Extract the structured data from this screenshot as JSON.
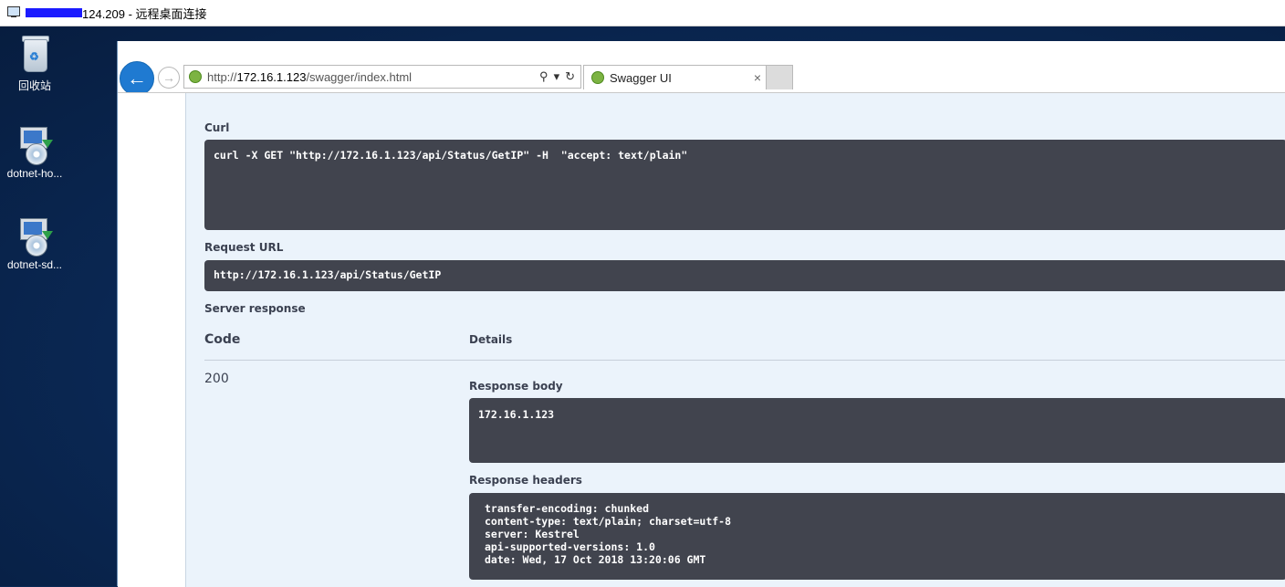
{
  "rdp": {
    "title_suffix": "124.209 - 远程桌面连接"
  },
  "desktop": {
    "icons": [
      {
        "label": "回收站"
      },
      {
        "label": "dotnet-ho..."
      },
      {
        "label": "dotnet-sd..."
      }
    ]
  },
  "browser": {
    "back_symbol": "←",
    "forward_symbol": "→",
    "address": {
      "prefix": "http://",
      "host": "172.16.1.123",
      "path": "/swagger/index.html"
    },
    "address_tools": {
      "search": "⚲",
      "dropdown": "▾",
      "refresh": "↻"
    },
    "tab": {
      "label": "Swagger UI",
      "close": "×"
    }
  },
  "swagger": {
    "curl_heading": "Curl",
    "curl_command": "curl -X GET \"http://172.16.1.123/api/Status/GetIP\" -H  \"accept: text/plain\"",
    "request_url_heading": "Request URL",
    "request_url": "http://172.16.1.123/api/Status/GetIP",
    "server_response_heading": "Server response",
    "table": {
      "code_header": "Code",
      "details_header": "Details",
      "status_code": "200"
    },
    "response_body_heading": "Response body",
    "response_body": "172.16.1.123",
    "response_headers_heading": "Response headers",
    "response_headers": [
      "transfer-encoding: chunked",
      "content-type: text/plain; charset=utf-8",
      "server: Kestrel",
      "api-supported-versions: 1.0",
      "date: Wed, 17 Oct 2018 13:20:06 GMT"
    ]
  }
}
